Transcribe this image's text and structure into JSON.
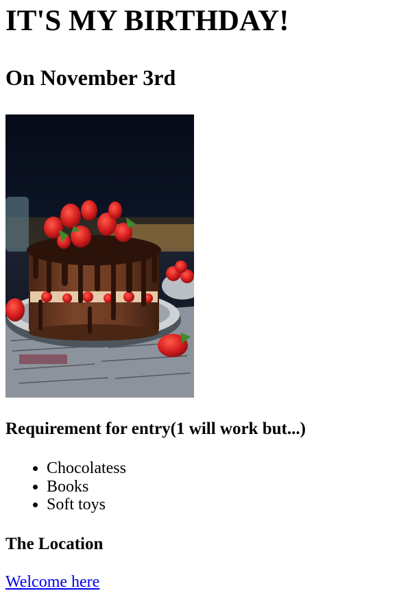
{
  "heading": {
    "title": "IT'S MY BIRTHDAY!",
    "subtitle": "On November 3rd"
  },
  "image": {
    "subject": "chocolate cake with strawberries",
    "colors": {
      "background_dark": "#0c1424",
      "table": "#b48a4a",
      "cake": "#6b3a22",
      "ganache": "#2b130a",
      "strawberry": "#d41e1e",
      "plate": "#cfd3d6",
      "newspaper": "#9aa0aa"
    }
  },
  "requirements": {
    "heading": "Requirement for entry(1 will work but...)",
    "items": [
      "Chocolatess",
      "Books",
      "Soft toys"
    ]
  },
  "location": {
    "heading": "The Location",
    "link_text": "Welcome here"
  },
  "colors": {
    "link": "#0000ee",
    "text": "#000000",
    "background": "#ffffff"
  }
}
